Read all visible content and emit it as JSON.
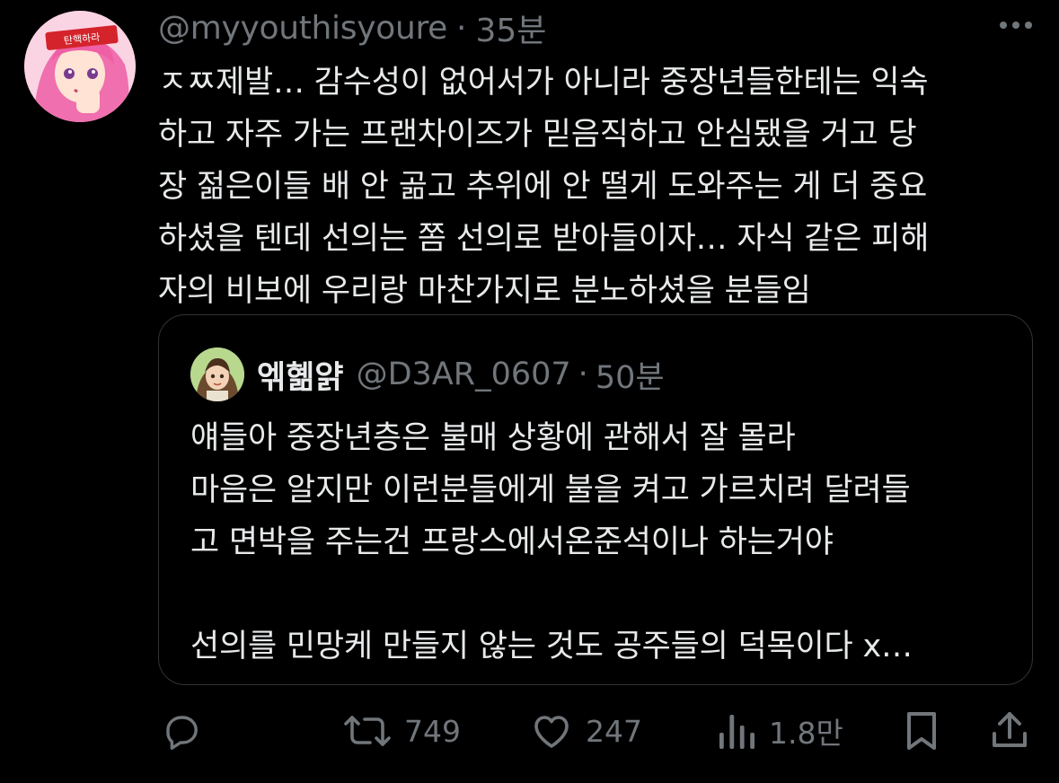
{
  "tweet": {
    "handle": "@myyouthisyoure",
    "separator": "·",
    "time": "35분",
    "text": "ㅈㅉ제발… 감수성이 없어서가 아니라 중장년들한테는 익숙\n하고 자주 가는 프랜차이즈가 믿음직하고 안심됐을 거고 당\n장 젊은이들 배 안 곪고 추위에 안 떨게 도와주는 게 더 중요\n하셨을 텐데 선의는 쫌 선의로 받아들이자… 자식 같은 피해\n자의 비보에 우리랑 마찬가지로 분노하셨을 분들임",
    "avatar_badge": "탄핵하라"
  },
  "quote": {
    "name": "엒혦얅",
    "handle": "@D3AR_0607",
    "separator": "·",
    "time": "50분",
    "text": "얘들아 중장년층은 불매 상황에 관해서 잘 몰라\n마음은 알지만 이런분들에게 불을 켜고 가르치려 달려들\n고 면박을 주는건 프랑스에서온준석이나 하는거야\n\n선의를 민망케 만들지 않는 것도 공주들의 덕목이다 x…"
  },
  "actions": {
    "reply": {
      "icon": "reply-icon",
      "count": ""
    },
    "retweet": {
      "icon": "retweet-icon",
      "count": "749"
    },
    "like": {
      "icon": "heart-icon",
      "count": "247"
    },
    "views": {
      "icon": "views-icon",
      "count": "1.8만"
    },
    "bookmark": {
      "icon": "bookmark-icon"
    },
    "share": {
      "icon": "share-icon"
    }
  },
  "colors": {
    "background": "#000000",
    "text": "#e7e9ea",
    "muted": "#71767b",
    "border": "#2f3336",
    "avatar_pink": "#f7a6c8",
    "badge_red": "#d4232b"
  }
}
